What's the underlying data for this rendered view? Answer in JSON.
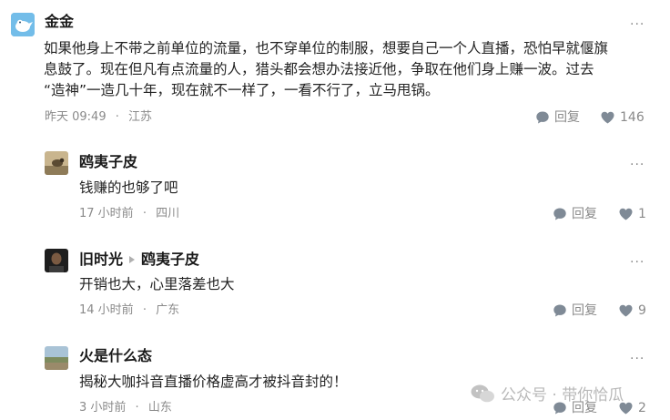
{
  "post": {
    "author": "金金",
    "content": [
      "如果他身上不带之前单位的流量，也不穿单位的制服，想要自己一个人直播，恐怕早就偃旗",
      "息鼓了。现在但凡有点流量的人，猎头都会想办法接近他，争取在他们身上赚一波。过去",
      "“造神”一造几十年，现在就不一样了，一看不行了，立马甩锅。"
    ],
    "time": "昨天 09:49",
    "location": "江苏",
    "reply_label": "回复",
    "likes": "146"
  },
  "separator": "·",
  "more": "···",
  "replies": [
    {
      "author": "鸥夷子皮",
      "reply_to": "",
      "content": "钱赚的也够了吧",
      "time": "17 小时前",
      "location": "四川",
      "reply_label": "回复",
      "likes": "1"
    },
    {
      "author": "旧时光",
      "reply_to": "鸥夷子皮",
      "content": "开销也大，心里落差也大",
      "time": "14 小时前",
      "location": "广东",
      "reply_label": "回复",
      "likes": "9"
    },
    {
      "author": "火是什么态",
      "reply_to": "",
      "content": "揭秘大咖抖音直播价格虚高才被抖音封的！",
      "time": "3 小时前",
      "location": "山东",
      "reply_label": "回复",
      "likes": "2"
    }
  ],
  "watermark": "公众号 · 带你恰瓜"
}
